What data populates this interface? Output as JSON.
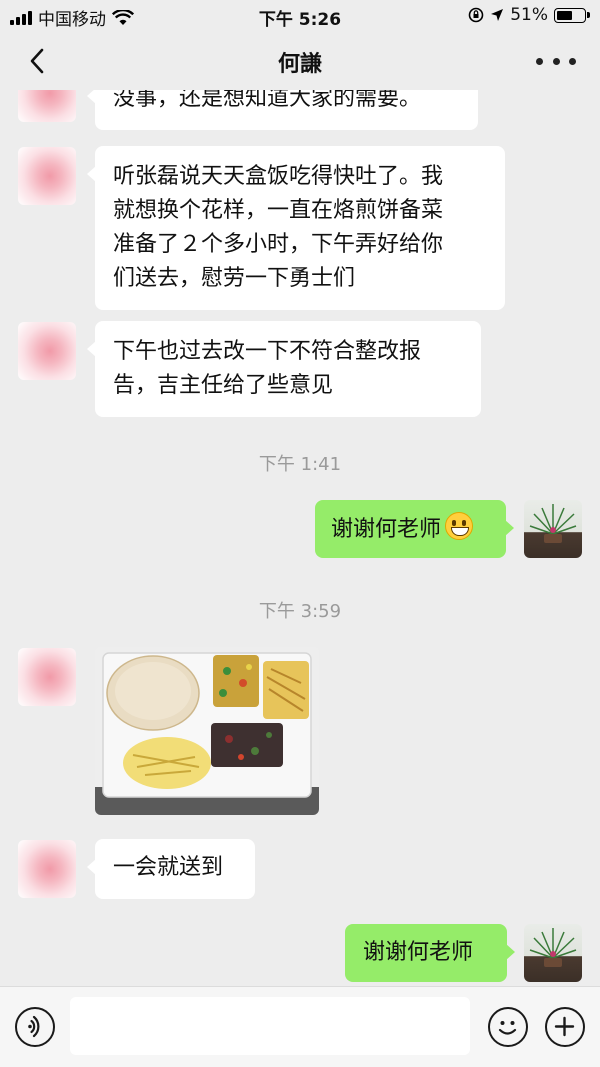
{
  "status_bar": {
    "carrier": "中国移动",
    "time": "下午 5:26",
    "battery": "51%"
  },
  "nav": {
    "title": "何謙",
    "back_icon": "chevron-left-icon",
    "more_icon": "more-dots-icon"
  },
  "messages": [
    {
      "side": "left",
      "type": "text",
      "text": "没事，还是想知道大家的需要。"
    },
    {
      "side": "left",
      "type": "text",
      "lines": [
        "听张磊说天天盒饭吃得快吐了。我",
        "就想换个花样，一直在烙煎饼备菜",
        "准备了２个多小时，下午弄好给你",
        "们送去，慰劳一下勇士们"
      ]
    },
    {
      "side": "left",
      "type": "text",
      "lines": [
        "下午也过去改一下不符合整改报",
        "告，吉主任给了些意见"
      ]
    },
    {
      "type": "timestamp",
      "text": "下午 1:41"
    },
    {
      "side": "right",
      "type": "text",
      "text": "谢谢何老师",
      "emoji": "grinning-face-icon"
    },
    {
      "type": "timestamp",
      "text": "下午 3:59"
    },
    {
      "side": "left",
      "type": "image",
      "icon": "food-photo"
    },
    {
      "side": "left",
      "type": "text",
      "text": "一会就送到"
    },
    {
      "side": "right",
      "type": "text",
      "text": "谢谢何老师"
    }
  ],
  "input_bar": {
    "voice_icon": "voice-icon",
    "emoji_icon": "emoji-icon",
    "add_icon": "plus-icon"
  },
  "colors": {
    "background": "#ededed",
    "sent_bubble": "#95ec69",
    "received_bubble": "#ffffff",
    "timestamp_text": "#9a9a9a"
  }
}
